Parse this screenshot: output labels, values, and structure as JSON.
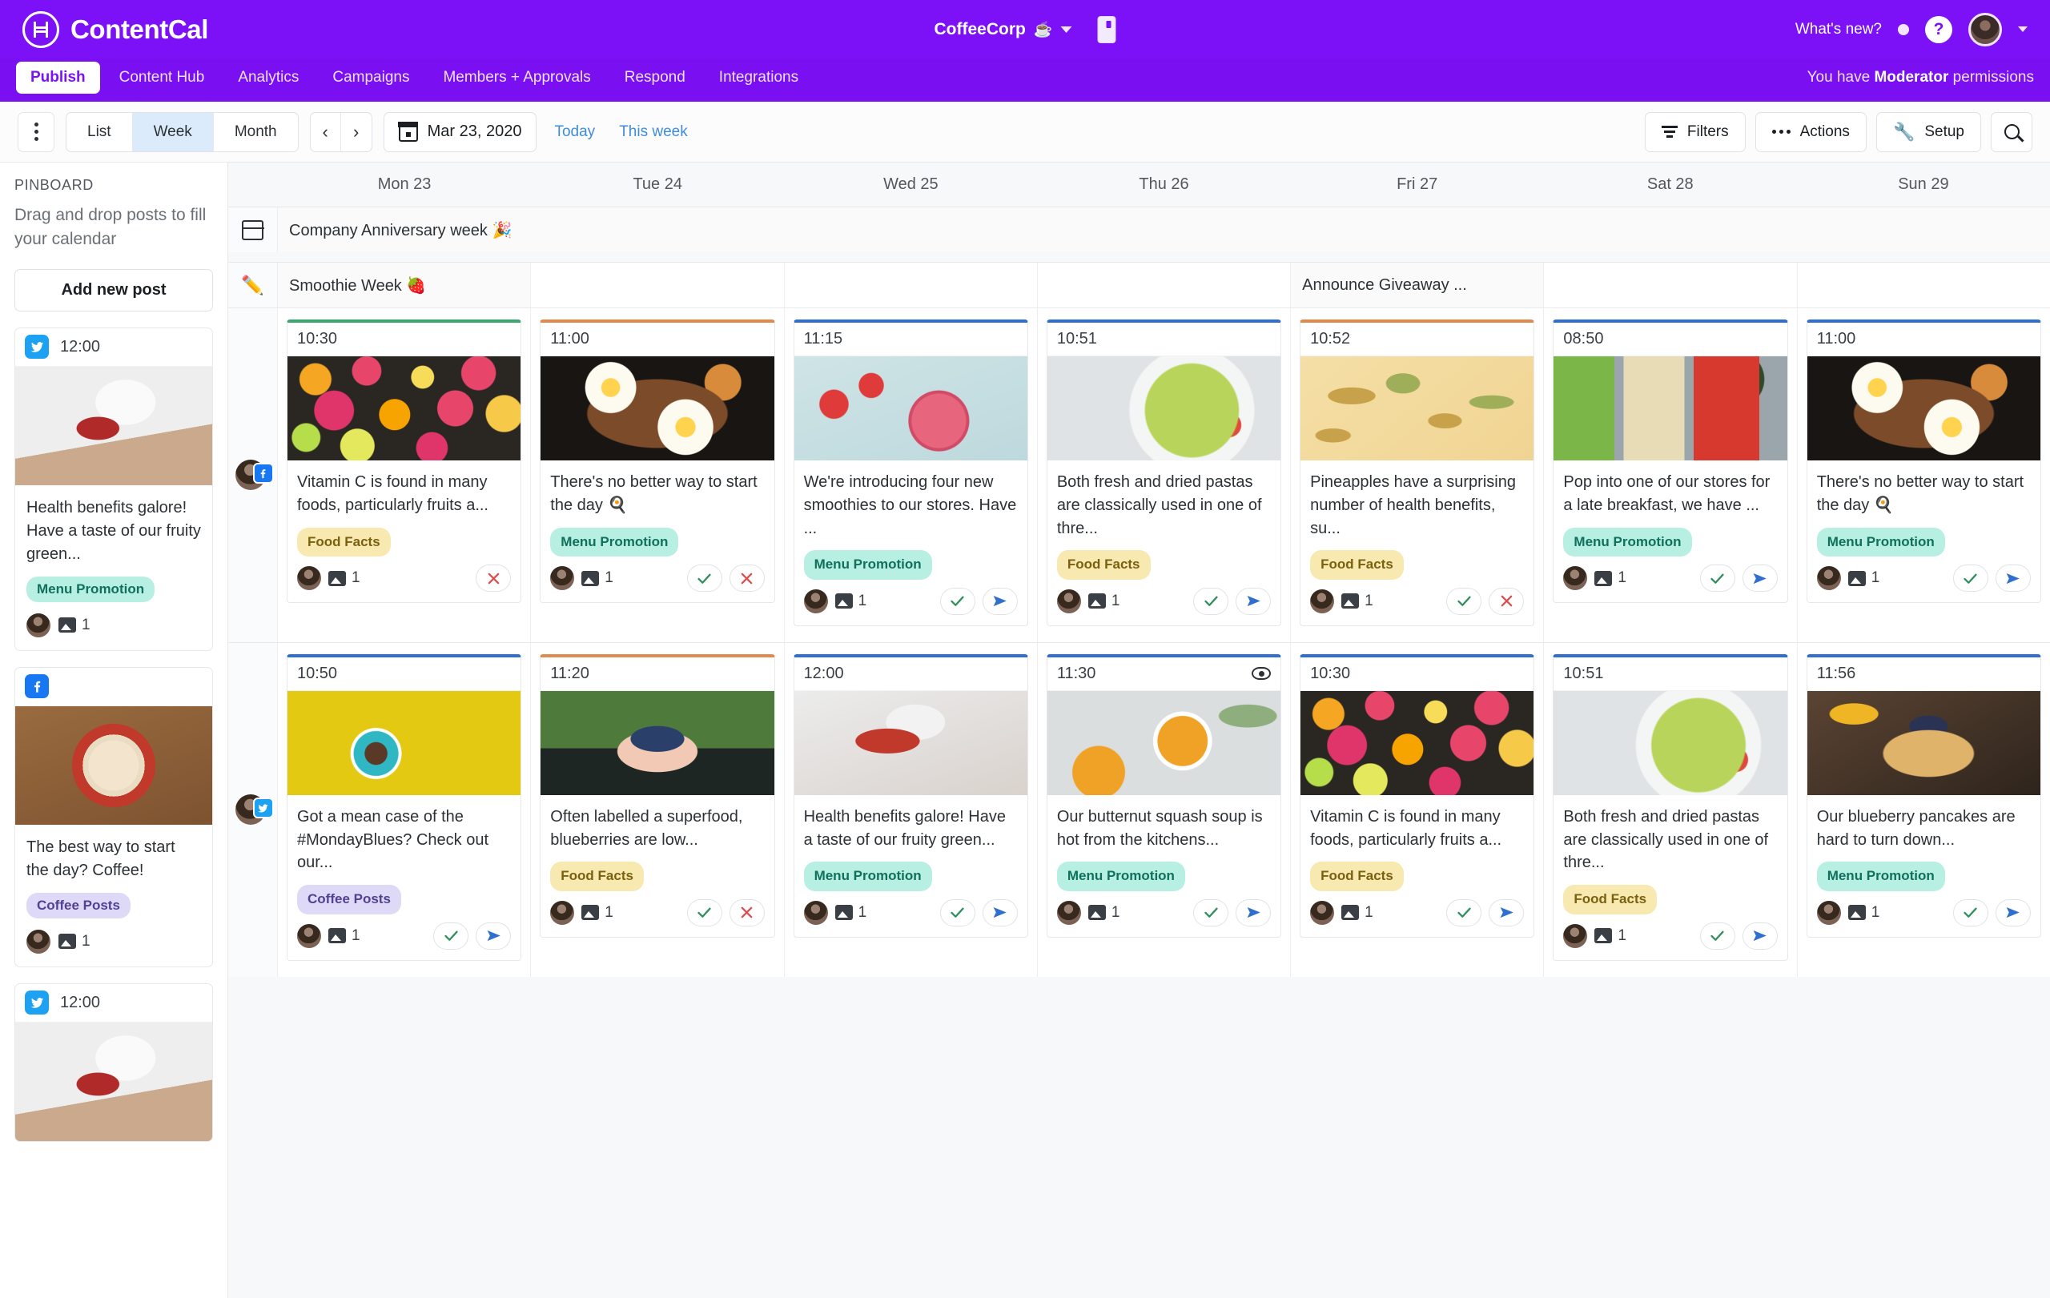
{
  "topbar": {
    "brand": "ContentCal",
    "workspace": "CoffeeCorp",
    "workspace_emoji": "☕",
    "whats_new": "What's new?",
    "help": "?"
  },
  "nav": {
    "tabs": [
      {
        "label": "Publish",
        "active": true
      },
      {
        "label": "Content Hub",
        "active": false
      },
      {
        "label": "Analytics",
        "active": false
      },
      {
        "label": "Campaigns",
        "active": false
      },
      {
        "label": "Members + Approvals",
        "active": false
      },
      {
        "label": "Respond",
        "active": false
      },
      {
        "label": "Integrations",
        "active": false
      }
    ],
    "permissions_prefix": "You have ",
    "permissions_role": "Moderator",
    "permissions_suffix": " permissions"
  },
  "toolbar": {
    "views": [
      {
        "label": "List",
        "active": false
      },
      {
        "label": "Week",
        "active": true
      },
      {
        "label": "Month",
        "active": false
      }
    ],
    "prev": "‹",
    "next": "›",
    "date": "Mar 23, 2020",
    "today": "Today",
    "this_week": "This week",
    "filters": "Filters",
    "actions": "Actions",
    "setup": "Setup"
  },
  "pinboard": {
    "title": "PINBOARD",
    "subtitle": "Drag and drop posts to fill your calendar",
    "add_button": "Add new post",
    "cards": [
      {
        "channel": "twitter",
        "time": "12:00",
        "photo": "ph-pour",
        "text": "Health benefits galore! Have a taste of our fruity green...",
        "tag": "Menu Promotion",
        "tag_class": "menu",
        "image_count": "1"
      },
      {
        "channel": "facebook",
        "time": "",
        "photo": "ph-latte",
        "text": "The best way to start the day? Coffee!",
        "tag": "Coffee Posts",
        "tag_class": "coffee",
        "image_count": "1"
      },
      {
        "channel": "twitter",
        "time": "12:00",
        "photo": "ph-pour",
        "text": "",
        "tag": "",
        "tag_class": "menu",
        "image_count": ""
      }
    ]
  },
  "calendar": {
    "days": [
      "Mon 23",
      "Tue 24",
      "Wed 25",
      "Thu 26",
      "Fri 27",
      "Sat 28",
      "Sun 29"
    ],
    "campaign_row": {
      "icon": "campaign-icon",
      "label": "Company Anniversary week 🎉"
    },
    "note_row": {
      "icon": "pencil-icon",
      "cells": [
        "Smoothie Week 🍓",
        "",
        "",
        "",
        "Announce Giveaway ...",
        "",
        ""
      ]
    },
    "rows": [
      {
        "channel": "facebook",
        "posts": [
          {
            "time": "10:30",
            "accent": "top-green",
            "photo": "ph-citrus",
            "text": "Vitamin C is found in many foods, particularly fruits a...",
            "tag": "Food Facts",
            "tag_class": "food",
            "image_count": "1",
            "eye": false,
            "actions": [
              "cross"
            ]
          },
          {
            "time": "11:00",
            "accent": "top-orange",
            "photo": "ph-eggs",
            "text": "There's no better way to start the day 🍳",
            "tag": "Menu Promotion",
            "tag_class": "menu",
            "image_count": "1",
            "eye": false,
            "actions": [
              "check",
              "cross"
            ]
          },
          {
            "time": "11:15",
            "accent": "top-blue",
            "photo": "ph-smoothie",
            "text": "We're introducing four new smoothies to our stores. Have ...",
            "tag": "Menu Promotion",
            "tag_class": "menu",
            "image_count": "1",
            "eye": false,
            "actions": [
              "check",
              "send"
            ]
          },
          {
            "time": "10:51",
            "accent": "top-blue",
            "photo": "ph-pasta",
            "text": "Both fresh and dried pastas are classically used in one of thre...",
            "tag": "Food Facts",
            "tag_class": "food",
            "image_count": "1",
            "eye": false,
            "actions": [
              "check",
              "send"
            ]
          },
          {
            "time": "10:52",
            "accent": "top-orange",
            "photo": "ph-pineapple",
            "text": "Pineapples have a surprising number of health benefits, su...",
            "tag": "Food Facts",
            "tag_class": "food",
            "image_count": "1",
            "eye": false,
            "actions": [
              "check",
              "cross"
            ]
          },
          {
            "time": "08:50",
            "accent": "top-blue",
            "photo": "ph-toast",
            "text": "Pop into one of our stores for a late breakfast, we have ...",
            "tag": "Menu Promotion",
            "tag_class": "menu",
            "image_count": "1",
            "eye": false,
            "actions": [
              "check",
              "send"
            ]
          },
          {
            "time": "11:00",
            "accent": "top-blue",
            "photo": "ph-eggs",
            "text": "There's no better way to start the day 🍳",
            "tag": "Menu Promotion",
            "tag_class": "menu",
            "image_count": "1",
            "eye": false,
            "actions": [
              "check",
              "send"
            ]
          }
        ]
      },
      {
        "channel": "twitter",
        "posts": [
          {
            "time": "10:50",
            "accent": "top-blue",
            "photo": "ph-cup-yellow",
            "text": "Got a mean case of the #MondayBlues? Check out our...",
            "tag": "Coffee Posts",
            "tag_class": "coffee",
            "image_count": "1",
            "eye": false,
            "actions": [
              "check",
              "send"
            ]
          },
          {
            "time": "11:20",
            "accent": "top-orange",
            "photo": "ph-blueberry-hands",
            "text": "Often labelled a superfood, blueberries are low...",
            "tag": "Food Facts",
            "tag_class": "food",
            "image_count": "1",
            "eye": false,
            "actions": [
              "check",
              "cross"
            ]
          },
          {
            "time": "12:00",
            "accent": "top-blue",
            "photo": "ph-juice",
            "text": "Health benefits galore! Have a taste of our fruity green...",
            "tag": "Menu Promotion",
            "tag_class": "menu",
            "image_count": "1",
            "eye": false,
            "actions": [
              "check",
              "send"
            ]
          },
          {
            "time": "11:30",
            "accent": "top-blue",
            "photo": "ph-soup",
            "text": "Our butternut squash soup is hot from the kitchens...",
            "tag": "Menu Promotion",
            "tag_class": "menu",
            "image_count": "1",
            "eye": true,
            "actions": [
              "check",
              "send"
            ]
          },
          {
            "time": "10:30",
            "accent": "top-blue",
            "photo": "ph-citrus",
            "text": "Vitamin C is found in many foods, particularly fruits a...",
            "tag": "Food Facts",
            "tag_class": "food",
            "image_count": "1",
            "eye": false,
            "actions": [
              "check",
              "send"
            ]
          },
          {
            "time": "10:51",
            "accent": "top-blue",
            "photo": "ph-pasta",
            "text": "Both fresh and dried pastas are classically used in one of thre...",
            "tag": "Food Facts",
            "tag_class": "food",
            "image_count": "1",
            "eye": false,
            "actions": [
              "check",
              "send"
            ]
          },
          {
            "time": "11:56",
            "accent": "top-blue",
            "photo": "ph-pancakes",
            "text": "Our blueberry pancakes are hard to turn down...",
            "tag": "Menu Promotion",
            "tag_class": "menu",
            "image_count": "1",
            "eye": false,
            "actions": [
              "check",
              "send"
            ]
          }
        ]
      }
    ]
  },
  "colors": {
    "brand_purple": "#7c10f7",
    "nav_purple": "#7a0ff2",
    "link_blue": "#3f8cdb",
    "tag_menu": "#b7f0e3",
    "tag_food": "#f7e9b0",
    "tag_coffee": "#ded9f7",
    "twitter": "#1da1f2",
    "facebook": "#1877f2"
  }
}
